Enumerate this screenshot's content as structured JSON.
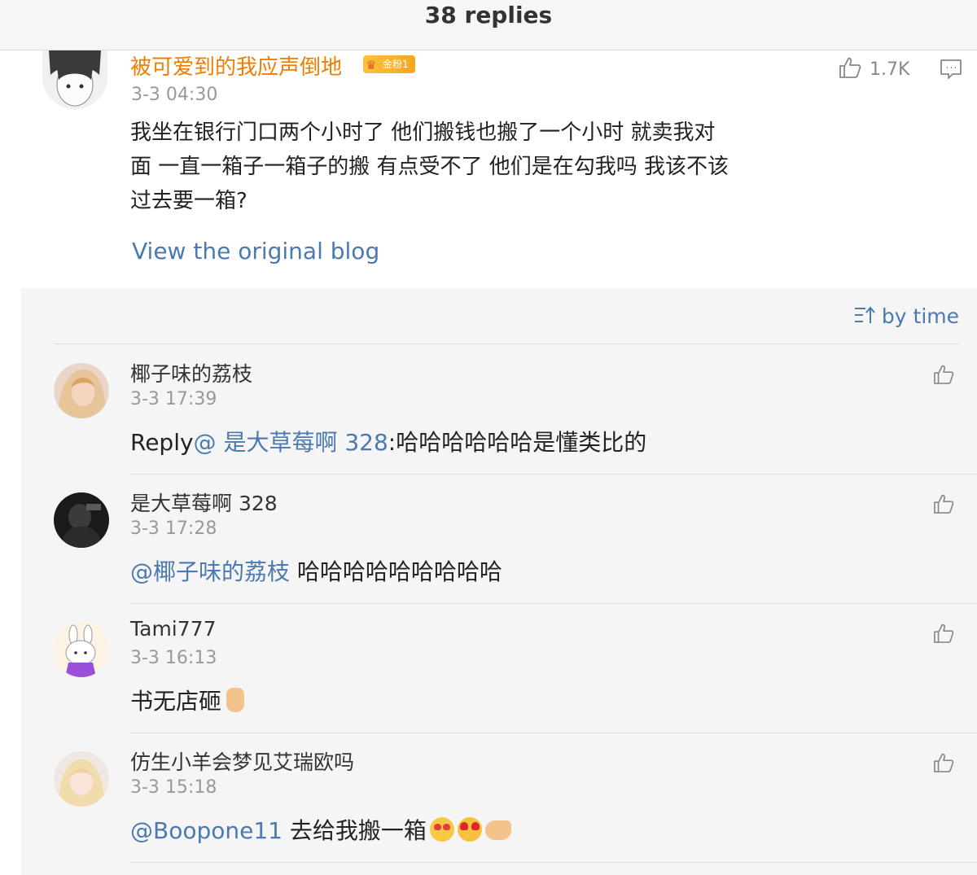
{
  "header": {
    "title": "38 replies"
  },
  "post": {
    "username": "被可爱到的我应声倒地",
    "badge": "金粉1",
    "time": "3-3 04:30",
    "content": "我坐在银行门口两个小时了 他们搬钱也搬了一个小时 就卖我对面 一直一箱子一箱子的搬 有点受不了 他们是在勾我吗 我该不该过去要一箱?",
    "like_count": "1.7K",
    "view_original": "View the original blog"
  },
  "sort": {
    "label": "by time"
  },
  "replies": [
    {
      "name": "椰子味的荔枝",
      "time": "3-3 17:39",
      "prefix": "Reply",
      "mention": "@ 是大草莓啊 328",
      "text": ":哈哈哈哈哈哈是懂类比的"
    },
    {
      "name": "是大草莓啊 328",
      "time": "3-3 17:28",
      "mention": "@椰子味的荔枝",
      "text": " 哈哈哈哈哈哈哈哈哈"
    },
    {
      "name": "Tami777",
      "time": "3-3 16:13",
      "text": "书无店砸"
    },
    {
      "name": "仿生小羊会梦见艾瑞欧吗",
      "time": "3-3 15:18",
      "mention": "@Boopone11",
      "text": " 去给我搬一箱"
    }
  ],
  "colors": {
    "link": "#4a7ab0",
    "username_highlight": "#f07c00",
    "muted": "#999999",
    "reply_bg": "#f5f5f5"
  }
}
